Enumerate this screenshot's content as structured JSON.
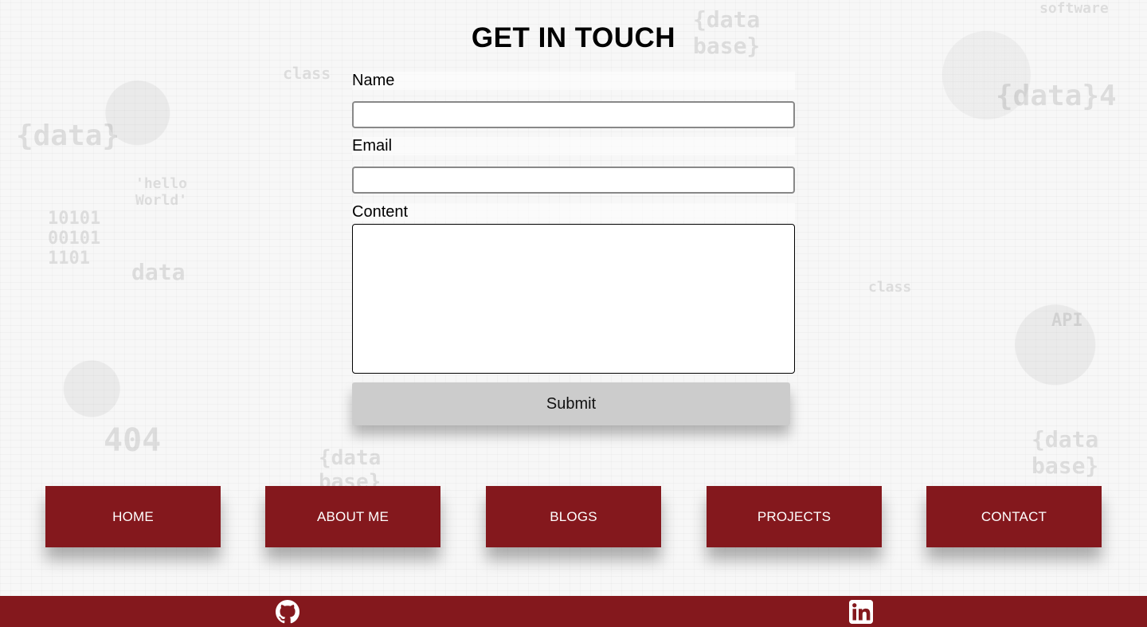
{
  "form": {
    "title": "GET IN TOUCH",
    "name_label": "Name",
    "name_value": "",
    "email_label": "Email",
    "email_value": "",
    "content_label": "Content",
    "content_value": "",
    "submit_label": "Submit"
  },
  "nav": {
    "items": [
      {
        "label": "HOME"
      },
      {
        "label": "ABOUT ME"
      },
      {
        "label": "BLOGS"
      },
      {
        "label": "PROJECTS"
      },
      {
        "label": "CONTACT"
      }
    ]
  },
  "footer": {
    "icons": [
      "github-icon",
      "linkedin-icon"
    ]
  },
  "colors": {
    "accent": "#84181d",
    "button_gray": "#cccccc",
    "background": "#f7f7f7"
  }
}
